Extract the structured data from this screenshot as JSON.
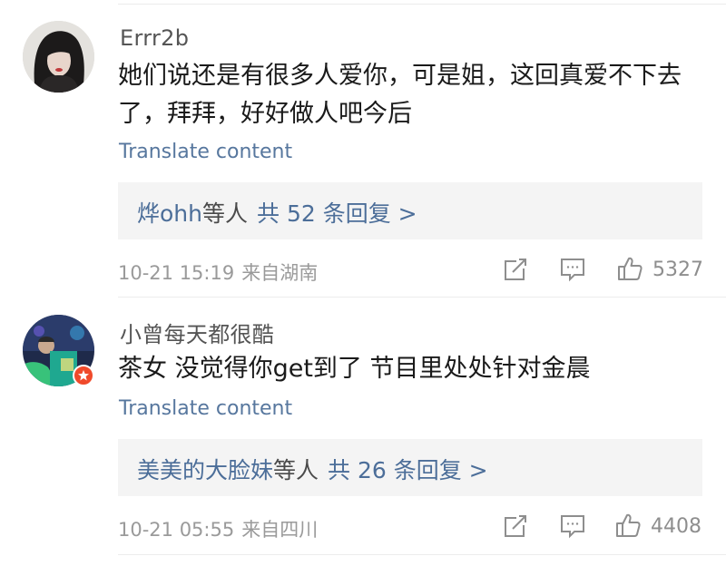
{
  "comments": [
    {
      "username": "Errr2b",
      "text_line1": "她们说还是有很多人爱你，可是姐，这回真爱不下去",
      "text_line2": "了，拜拜，好好做人吧今后",
      "translate": "Translate content",
      "reply": {
        "users": "烨ohh",
        "etc": "等人",
        "summary": "共 52 条回复 >"
      },
      "time": "10-21 15:19",
      "location": "来自湖南",
      "likes": "5327",
      "icons": [
        "share-icon",
        "comment-icon",
        "like-icon"
      ]
    },
    {
      "username": "小曾每天都很酷",
      "text_line1": "茶女 没觉得你get到了 节目里处处针对金晨",
      "translate": "Translate content",
      "reply": {
        "users": "美美的大脸妹",
        "etc": "等人",
        "summary": "共 26 条回复 >"
      },
      "time": "10-21 05:55",
      "location": "来自四川",
      "likes": "4408",
      "icons": [
        "share-icon",
        "comment-icon",
        "like-icon"
      ],
      "badge": "vip-badge-icon"
    }
  ],
  "colors": {
    "link_blue": "#4c6e99",
    "translate_blue": "#57779e",
    "meta_gray": "#9a9a9a",
    "reply_bg": "#f4f4f4",
    "badge_red": "#f04a2b"
  }
}
